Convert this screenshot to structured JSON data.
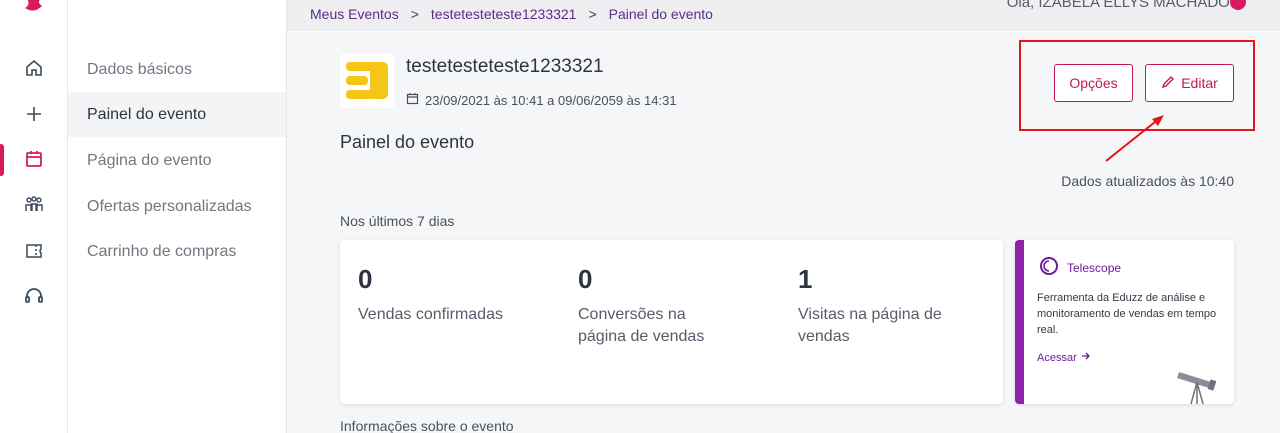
{
  "breadcrumb": {
    "items": [
      "Meus Eventos",
      "testetesteteste1233321",
      "Painel do evento"
    ],
    "separator": ">"
  },
  "user": {
    "greeting": "Olá, IZABELA ELLYS MACHADO!"
  },
  "rail": {
    "icons": [
      "logo",
      "home-icon",
      "plus-icon",
      "calendar-icon",
      "people-icon",
      "ticket-icon",
      "headset-icon"
    ],
    "active": "calendar-icon",
    "accent": "#d81b60"
  },
  "submenu": {
    "items": [
      {
        "label": "Dados básicos"
      },
      {
        "label": "Painel do evento",
        "active": true
      },
      {
        "label": "Página do evento"
      },
      {
        "label": "Ofertas personalizadas"
      },
      {
        "label": "Carrinho de compras"
      }
    ]
  },
  "event": {
    "title": "testetesteteste1233321",
    "dates": "23/09/2021 às 10:41 a 09/06/2059 às 14:31"
  },
  "actions": {
    "options_label": "Opções",
    "edit_label": "Editar"
  },
  "panel": {
    "title": "Painel do evento",
    "updated": "Dados atualizados às 10:40",
    "period": "Nos últimos 7 dias",
    "stats": [
      {
        "value": "0",
        "label": "Vendas confirmadas"
      },
      {
        "value": "0",
        "label": "Conversões na página de vendas"
      },
      {
        "value": "1",
        "label": "Visitas na página de vendas"
      }
    ]
  },
  "telescope": {
    "name": "Telescope",
    "description": "Ferramenta da Eduzz de análise e monitoramento de vendas em tempo real.",
    "link": "Acessar",
    "accent": "#8e24aa"
  },
  "info_heading": "Informações sobre o evento"
}
